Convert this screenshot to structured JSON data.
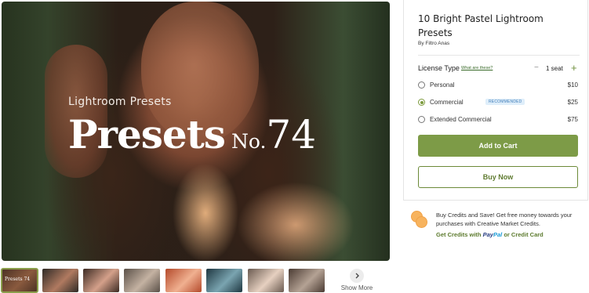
{
  "hero": {
    "subtitle": "Lightroom Presets",
    "title_main": "Presets",
    "title_no": "No.",
    "title_num": "74"
  },
  "thumbnails": [
    {
      "label": "Presets 74",
      "colors": [
        "#4a3024",
        "#8a5a3e"
      ]
    },
    {
      "label": "",
      "colors": [
        "#2e2a26",
        "#b07a60"
      ]
    },
    {
      "label": "",
      "colors": [
        "#3c2a22",
        "#d4a08a"
      ]
    },
    {
      "label": "",
      "colors": [
        "#5a5048",
        "#c4b2a2"
      ]
    },
    {
      "label": "",
      "colors": [
        "#b4492a",
        "#f0b090"
      ]
    },
    {
      "label": "",
      "colors": [
        "#1e3640",
        "#7aa4b0"
      ]
    },
    {
      "label": "",
      "colors": [
        "#6a5a50",
        "#e6d0c0"
      ]
    },
    {
      "label": "",
      "colors": [
        "#4a3a32",
        "#b4a294"
      ]
    }
  ],
  "show_more": {
    "label": "Show More"
  },
  "product": {
    "title": "10 Bright Pastel Lightroom Presets",
    "by_prefix": "By",
    "author": "Filtro Anas"
  },
  "license": {
    "label": "License Type",
    "help_link": "What are these?",
    "seat_minus": "−",
    "seat_count": "1 seat",
    "seat_plus": "+",
    "options": [
      {
        "name": "Personal",
        "price": "$10",
        "selected": false,
        "badge": ""
      },
      {
        "name": "Commercial",
        "price": "$25",
        "selected": true,
        "badge": "RECOMMENDED"
      },
      {
        "name": "Extended Commercial",
        "price": "$75",
        "selected": false,
        "badge": ""
      }
    ]
  },
  "buttons": {
    "add_to_cart": "Add to Cart",
    "buy_now": "Buy Now"
  },
  "credits": {
    "text": "Buy Credits and Save! Get free money towards your purchases with Creative Market Credits.",
    "link_prefix": "Get Credits with",
    "paypal_pay": "Pay",
    "paypal_pal": "Pal",
    "link_suffix": "or Credit Card"
  },
  "colors": {
    "accent_green": "#7d9b47",
    "badge_bg": "#dfeefa",
    "badge_text": "#3e7cb8",
    "coin": "#f7b35e"
  },
  "icons": {
    "show_more": "chevron-right-icon",
    "credits": "coins-icon"
  }
}
